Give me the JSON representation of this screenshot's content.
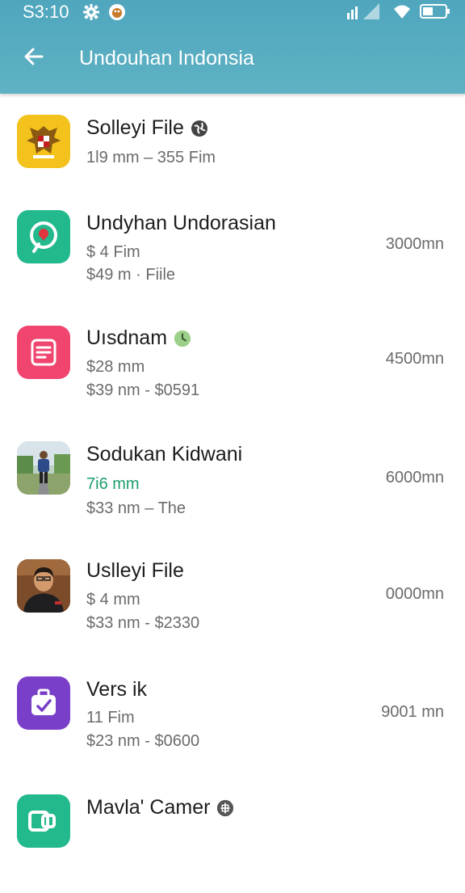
{
  "status_bar": {
    "time": "S3:10",
    "icons": [
      "settings-gear-icon",
      "notification-app-icon",
      "signal-icon",
      "wifi-icon",
      "battery-icon"
    ]
  },
  "app_bar": {
    "title": "Undouhan Indonsia",
    "back_icon": "arrow-left-icon"
  },
  "items": [
    {
      "title": "Solleyi File",
      "line1": "1l9 mm  – 355 Fim",
      "line2": "",
      "size": "",
      "icon": "garuda-emblem-icon",
      "badge": "globe-icon"
    },
    {
      "title": "Undyhan Undorasian",
      "line1": "$ 4 Fim",
      "line2": "$49 m · Fiile",
      "size": "3000mn",
      "icon": "location-pin-icon",
      "badge": ""
    },
    {
      "title": "Uısdnam",
      "line1": "$28 mm",
      "line2": "$39 nm - $0591",
      "size": "4500mn",
      "icon": "document-list-icon",
      "badge": "clock-icon"
    },
    {
      "title": "Sodukan Kidwani",
      "line1": "7i6 mm",
      "line2": "$33 nm  – The",
      "size": "6000mn",
      "icon": "person-photo-icon",
      "badge": ""
    },
    {
      "title": "Uslleyi File",
      "line1": "$ 4 mm",
      "line2": "$33 nm - $2330",
      "size": "0000mn",
      "icon": "man-portrait-icon",
      "badge": ""
    },
    {
      "title": "Vers ik",
      "line1": "11  Fim",
      "line2": "$23 nm - $0600",
      "size": "9001 mn",
      "icon": "briefcase-check-icon",
      "badge": ""
    },
    {
      "title": "Mavla' Camer",
      "line1": "",
      "line2": "",
      "size": "",
      "icon": "camera-app-icon",
      "badge": "plugin-icon"
    }
  ],
  "colors": {
    "app_bar": "#55abc0",
    "accent_green": "#1c9d6c",
    "icon_yellow": "#f4c21c",
    "icon_teal": "#22b98c",
    "icon_pink": "#f0456f",
    "icon_purple": "#7a3fc8"
  }
}
